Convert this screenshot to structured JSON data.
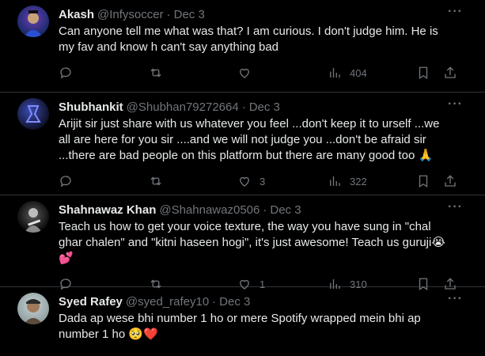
{
  "tweets": [
    {
      "name": "Akash",
      "handle": "@Infysoccer",
      "date": "Dec 3",
      "text": "Can anyone tell me what was that? I am curious. I don't judge him. He  is my fav and know h can't say anything bad",
      "reply_count": "",
      "retweet_count": "",
      "like_count": "",
      "view_count": "404",
      "avatar_colors": [
        "#1a2a6b",
        "#6a3fb5"
      ]
    },
    {
      "name": "Shubhankit",
      "handle": "@Shubhan79272664",
      "date": "Dec 3",
      "text": "Arijit sir just share with us whatever you feel ...don't keep it to urself ...we all are here for you sir ....and we will not judge you ...don't be afraid sir ...there are bad people on this platform but there are many good too 🙏",
      "reply_count": "",
      "retweet_count": "",
      "like_count": "3",
      "view_count": "322",
      "avatar_colors": [
        "#0c0f22",
        "#3b4bb0"
      ]
    },
    {
      "name": "Shahnawaz Khan",
      "handle": "@Shahnawaz0506",
      "date": "Dec 3",
      "text": "Teach us how to get your voice texture, the way you have sung in \"chal ghar chalen\" and \"kitni haseen hogi\", it's just awesome! Teach us guruji😭💕",
      "reply_count": "",
      "retweet_count": "",
      "like_count": "1",
      "view_count": "310",
      "avatar_colors": [
        "#0d0d0d",
        "#5a5a5a"
      ]
    },
    {
      "name": "Syed Rafey",
      "handle": "@syed_rafey10",
      "date": "Dec 3",
      "text": "Dada ap wese bhi number 1 ho or mere Spotify wrapped mein bhi ap number 1 ho 🥺❤️",
      "reply_count": "",
      "retweet_count": "",
      "like_count": "",
      "view_count": "",
      "avatar_colors": [
        "#c9d4d6",
        "#5c4a3a"
      ]
    }
  ],
  "colors": {
    "background": "#000000",
    "text": "#e7e9ea",
    "secondary": "#71767b",
    "border": "#2f3336"
  }
}
